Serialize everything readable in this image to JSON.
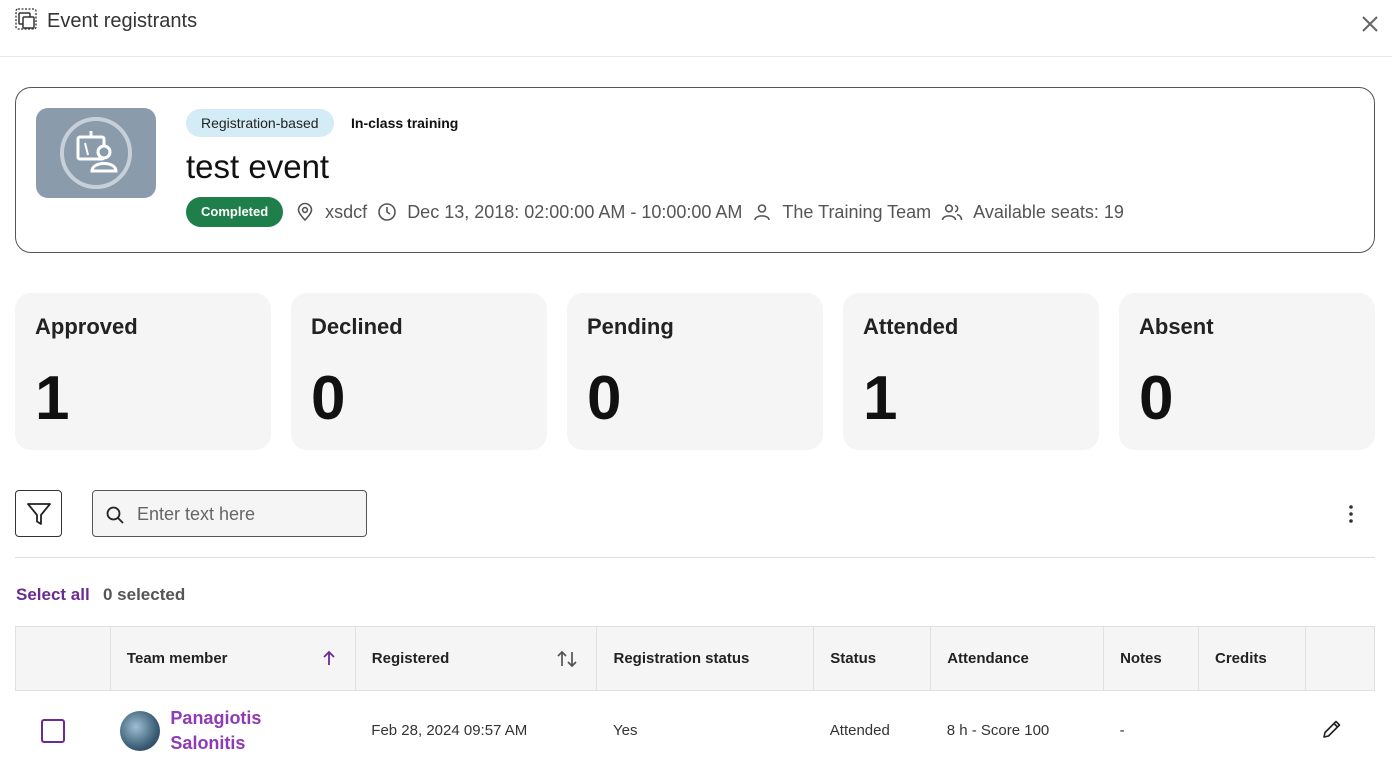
{
  "header": {
    "title": "Event registrants",
    "app_icon": "window-copy-icon",
    "close_icon": "close-icon"
  },
  "event": {
    "type_badge": "Registration-based",
    "kind": "In-class training",
    "title": "test event",
    "status": "Completed",
    "location": "xsdcf",
    "datetime": "Dec 13, 2018: 02:00:00 AM - 10:00:00 AM",
    "instructor": "The Training Team",
    "seats": "Available seats: 19",
    "colors": {
      "type_badge_bg": "#d3ecf5",
      "status_bg": "#1e7f4a",
      "thumbnail_bg": "#8a9bab"
    }
  },
  "stats": [
    {
      "label": "Approved",
      "value": "1"
    },
    {
      "label": "Declined",
      "value": "0"
    },
    {
      "label": "Pending",
      "value": "0"
    },
    {
      "label": "Attended",
      "value": "1"
    },
    {
      "label": "Absent",
      "value": "0"
    }
  ],
  "toolbar": {
    "search_placeholder": "Enter text here",
    "select_all": "Select all",
    "selected_count": "0 selected"
  },
  "table": {
    "columns": [
      "Team member",
      "Registered",
      "Registration status",
      "Status",
      "Attendance",
      "Notes",
      "Credits"
    ],
    "rows": [
      {
        "member": "Panagiotis Salonitis",
        "registered": "Feb 28, 2024 09:57 AM",
        "registration_status": "Yes",
        "status": "Attended",
        "attendance": "8 h - Score 100",
        "notes": "-",
        "credits": ""
      }
    ]
  },
  "accent_color": "#6b2c91"
}
